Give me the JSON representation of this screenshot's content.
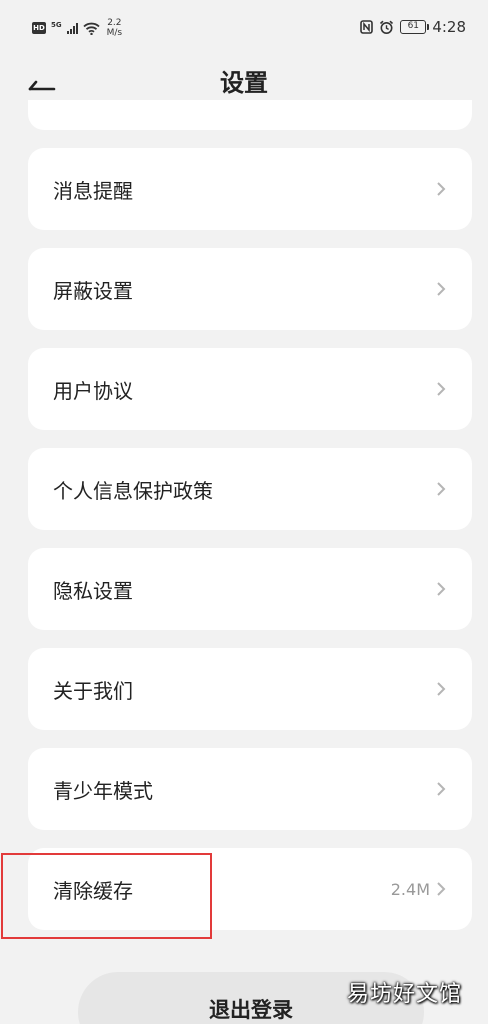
{
  "status_bar": {
    "hd": "HD",
    "network": "5G",
    "speed_value": "2.2",
    "speed_unit": "M/s",
    "battery": "61",
    "time": "4:28"
  },
  "nav": {
    "title": "设置"
  },
  "menu": [
    {
      "label": "消息提醒",
      "value": ""
    },
    {
      "label": "屏蔽设置",
      "value": ""
    },
    {
      "label": "用户协议",
      "value": ""
    },
    {
      "label": "个人信息保护政策",
      "value": ""
    },
    {
      "label": "隐私设置",
      "value": ""
    },
    {
      "label": "关于我们",
      "value": ""
    },
    {
      "label": "青少年模式",
      "value": ""
    },
    {
      "label": "清除缓存",
      "value": "2.4M"
    }
  ],
  "logout_label": "退出登录",
  "watermark": "易坊好文馆",
  "colors": {
    "background": "#f2f2f2",
    "card": "#ffffff",
    "highlight": "#e23a3a",
    "secondary_text": "#999999"
  },
  "icons": {
    "back": "back-arrow-icon",
    "chevron": "chevron-right-icon"
  }
}
